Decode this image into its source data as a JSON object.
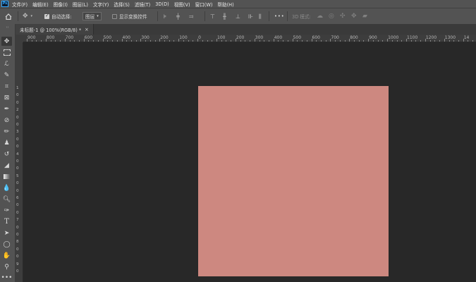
{
  "app": {
    "logo_text": "Ps"
  },
  "menu": [
    "文件(F)",
    "编辑(E)",
    "图像(I)",
    "图层(L)",
    "文字(Y)",
    "选择(S)",
    "滤镜(T)",
    "3D(D)",
    "视图(V)",
    "窗口(W)",
    "帮助(H)"
  ],
  "options": {
    "home_icon": "home-icon",
    "move_icon": "move-icon",
    "auto_select_label": "自动选择:",
    "auto_select_checked": true,
    "layer_dropdown_value": "图层",
    "show_transform_label": "显示变换控件",
    "show_transform_checked": false,
    "more_label": "•••",
    "mode_3d_label": "3D 模式:"
  },
  "document": {
    "tab_title": "未标题-1 @ 100%(RGB/8) *",
    "close_label": "×",
    "fill_color": "#cd8880"
  },
  "ruler": {
    "horizontal_labels": [
      "900",
      "800",
      "700",
      "600",
      "500",
      "400",
      "300",
      "200",
      "100",
      "0",
      "100",
      "200",
      "300",
      "400",
      "500",
      "600",
      "700",
      "800",
      "900",
      "1000",
      "1100",
      "1200",
      "1300",
      "14"
    ],
    "vertical_labels": [
      "1",
      "0",
      "0",
      "2",
      "0",
      "0",
      "3",
      "0",
      "0",
      "4",
      "0",
      "0",
      "5",
      "0",
      "0",
      "6",
      "0",
      "0",
      "7",
      "0",
      "0",
      "8",
      "0",
      "0",
      "9",
      "0"
    ]
  },
  "tools": [
    "move-tool-icon",
    "marquee-tool-icon",
    "lasso-tool-icon",
    "quick-select-tool-icon",
    "crop-tool-icon",
    "frame-tool-icon",
    "eyedropper-tool-icon",
    "spot-healing-tool-icon",
    "brush-tool-icon",
    "clone-stamp-tool-icon",
    "history-brush-tool-icon",
    "eraser-tool-icon",
    "gradient-tool-icon",
    "blur-tool-icon",
    "dodge-tool-icon",
    "pen-tool-icon",
    "type-tool-icon",
    "path-select-tool-icon",
    "ellipse-tool-icon",
    "hand-tool-icon",
    "zoom-tool-icon",
    "more-tools-icon"
  ],
  "colors": {
    "menubar_bg": "#535353",
    "workspace_bg": "#282828",
    "canvas_fill": "#cd8880"
  }
}
